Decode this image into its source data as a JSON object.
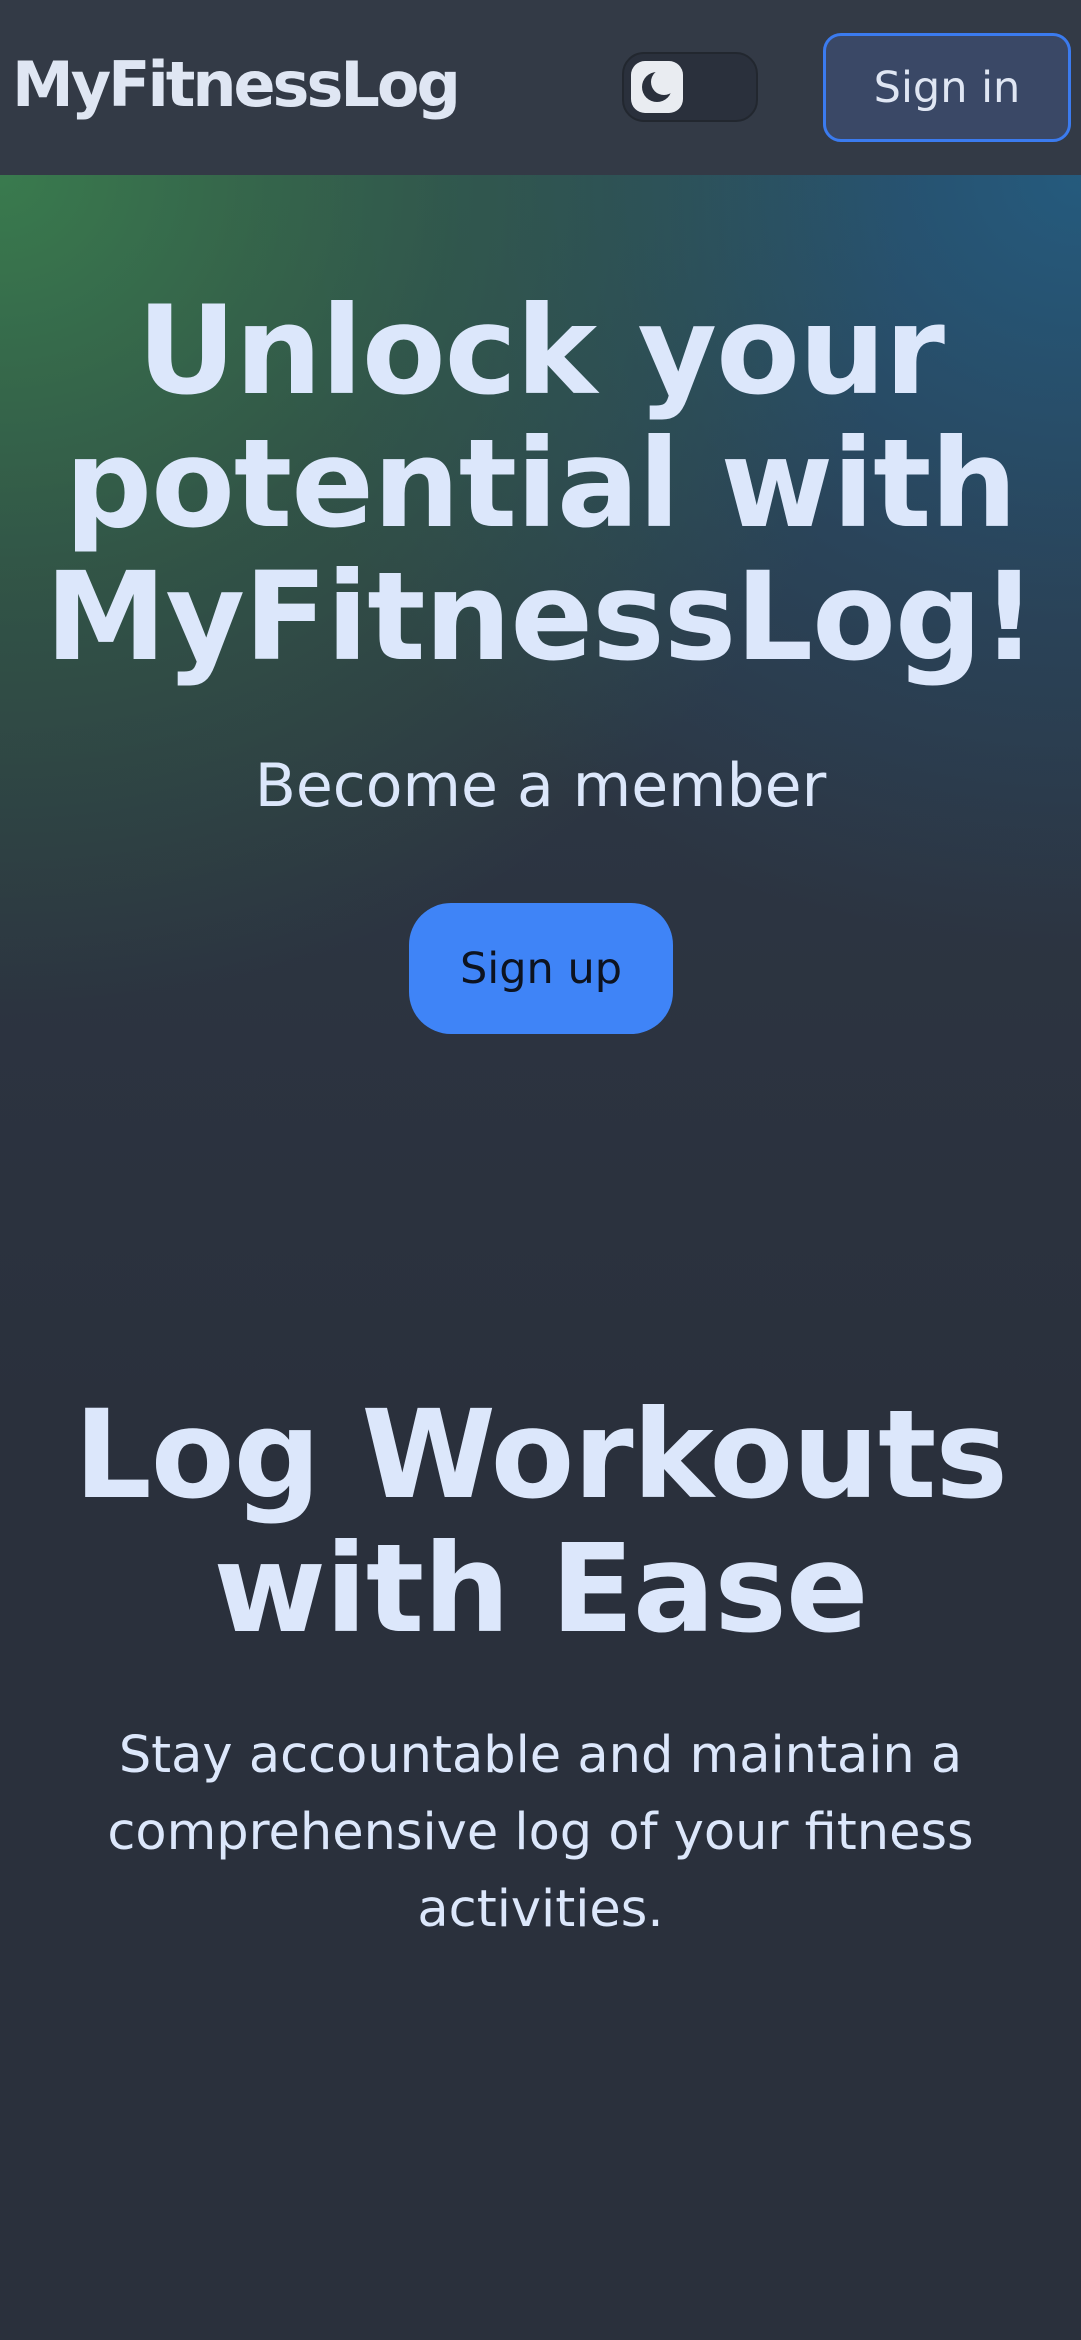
{
  "header": {
    "brand": "MyFitnessLog",
    "theme_toggle_icon": "moon-icon",
    "signin_label": "Sign in"
  },
  "hero": {
    "title": "Unlock your potential with MyFitnessLog!",
    "subtitle": "Become a member",
    "signup_label": "Sign up"
  },
  "feature": {
    "title": "Log Workouts with Ease",
    "text": "Stay accountable and maintain a comprehensive log of your fitness activities."
  },
  "colors": {
    "accent": "#3f84f7",
    "header_bg": "#333a46",
    "page_bg": "#2a303c",
    "text": "#dce7fb"
  }
}
